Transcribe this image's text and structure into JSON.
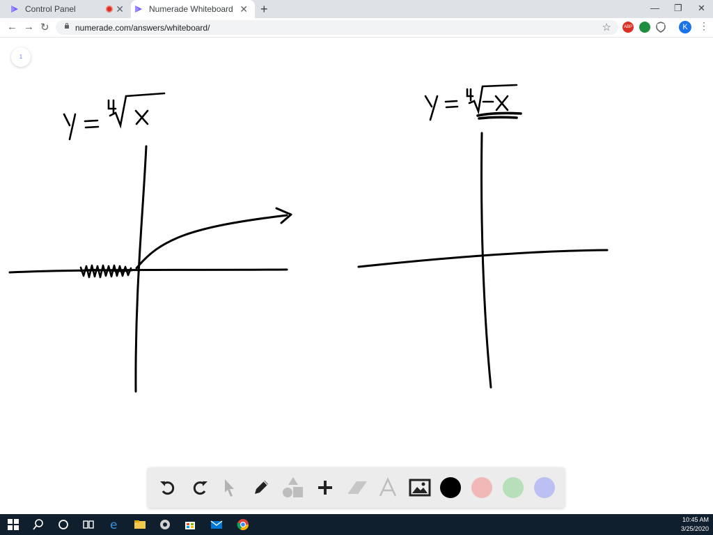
{
  "browser": {
    "tabs": [
      {
        "title": "Control Panel",
        "recording": true
      },
      {
        "title": "Numerade Whiteboard",
        "active": true
      }
    ],
    "url": "numerade.com/answers/whiteboard/",
    "profile_initial": "K",
    "extension_badge": "ABP"
  },
  "whiteboard": {
    "page_number": "1",
    "left_equation": {
      "lhs": "y =",
      "index": "4",
      "radicand": "x"
    },
    "right_equation": {
      "lhs": "y =",
      "index": "4",
      "radicand": "-x"
    },
    "colors": {
      "black": "#000000",
      "red": "#f2b8b8",
      "green": "#b7dfb9",
      "blue": "#bcbff2"
    }
  },
  "toolbar_tools": [
    "undo-icon",
    "redo-icon",
    "pointer-icon",
    "pencil-icon",
    "shapes-icon",
    "add-icon",
    "eraser-icon",
    "text-icon",
    "image-icon"
  ],
  "taskbar": {
    "time": "10:45 AM",
    "date": "3/25/2020"
  }
}
